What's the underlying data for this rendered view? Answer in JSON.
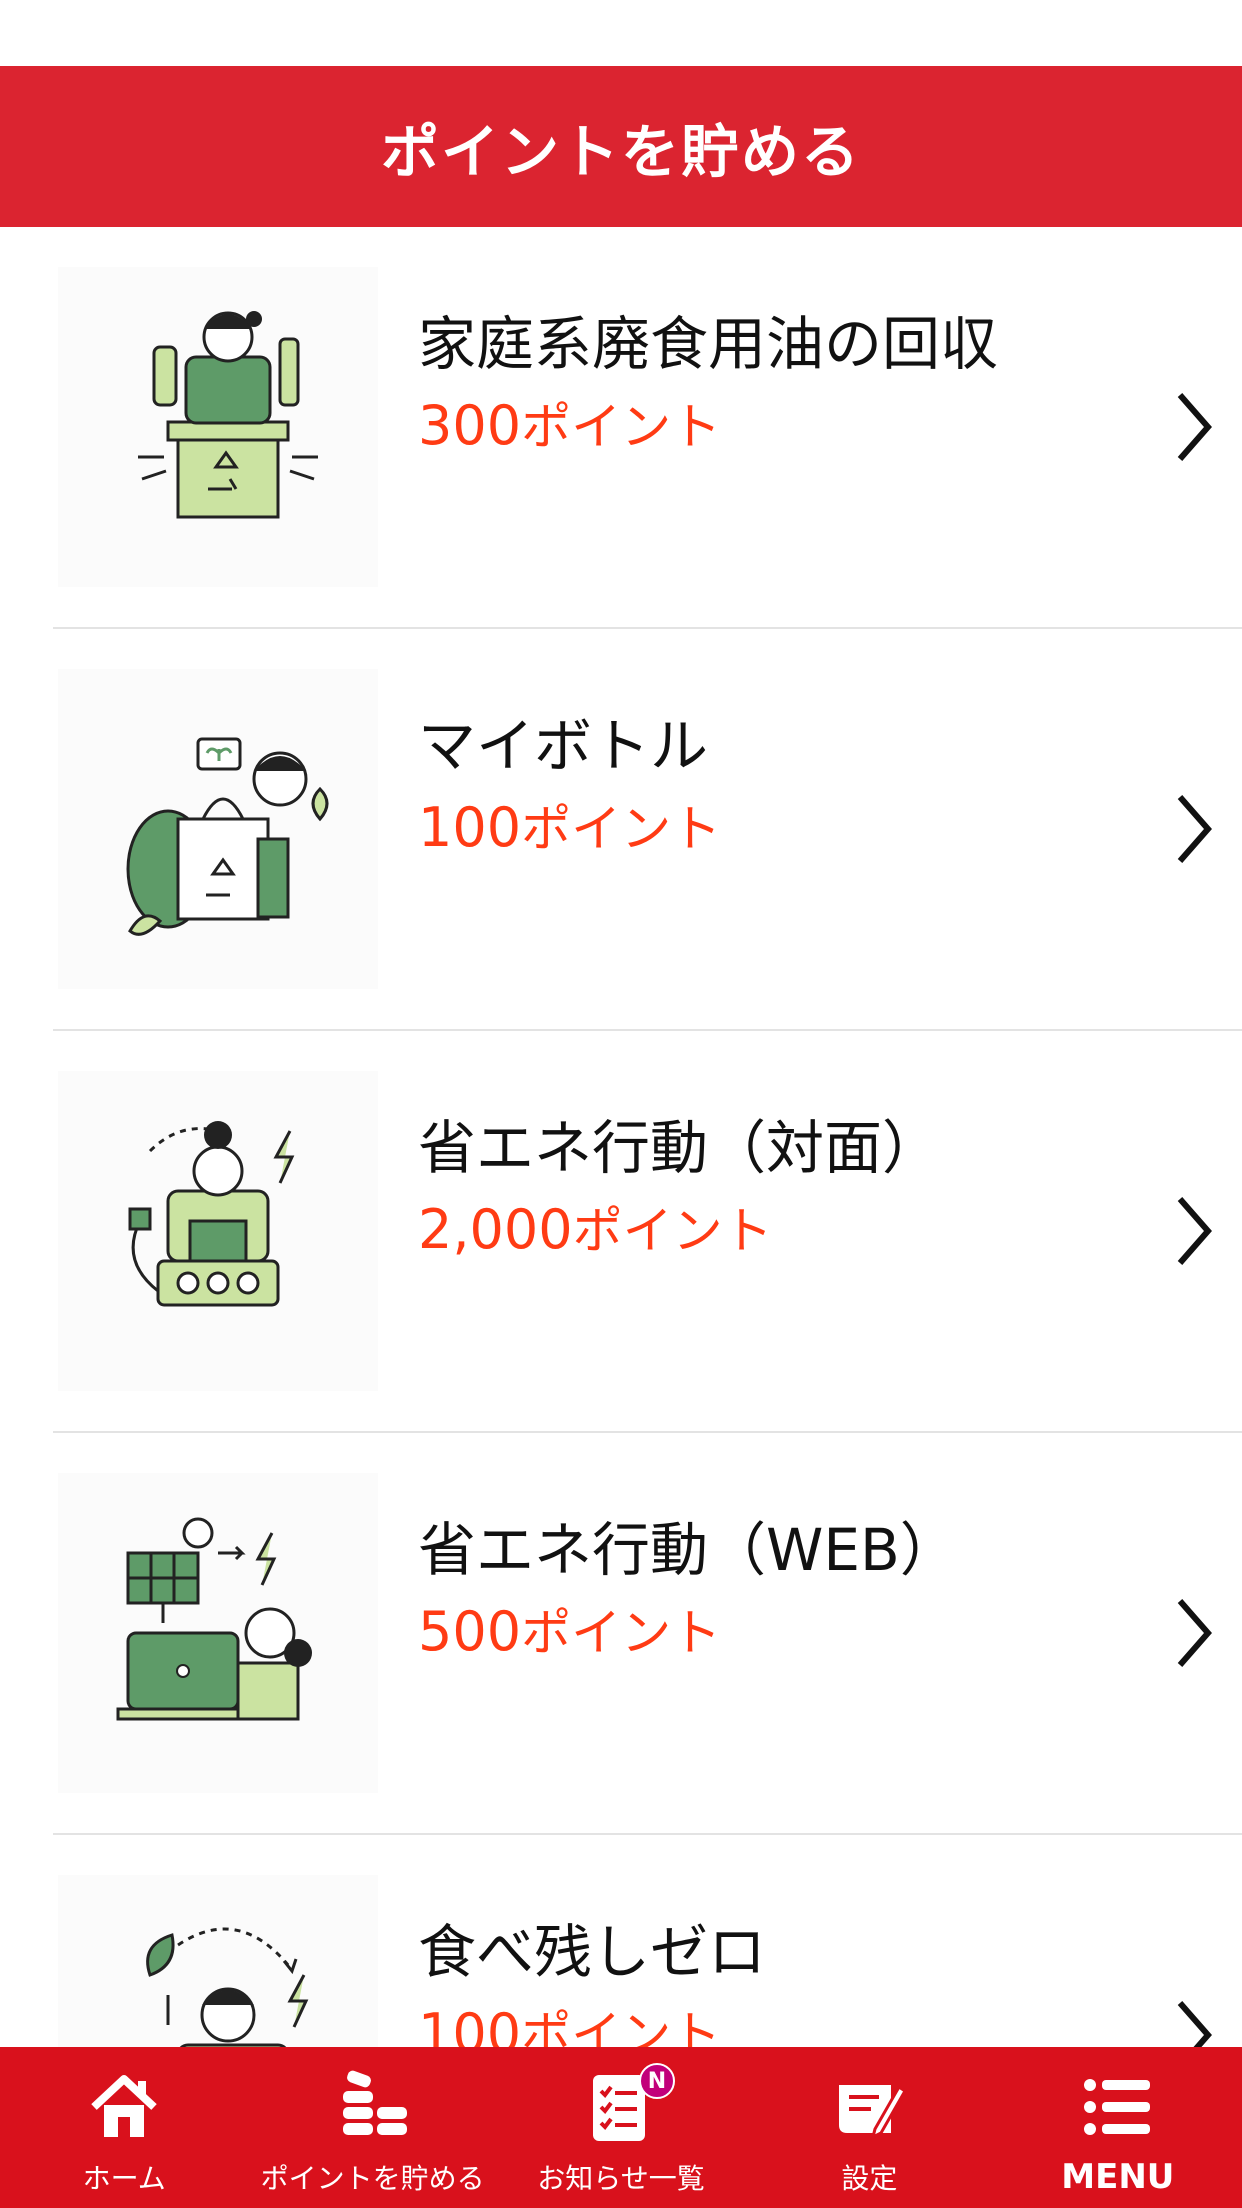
{
  "header": {
    "title": "ポイントを貯める"
  },
  "items": [
    {
      "name": "家庭系廃食用油の回収",
      "points_value": "300",
      "points_unit": "ポイント",
      "icon": "oil-recycling-illustration"
    },
    {
      "name": "マイボトル",
      "points_value": "100",
      "points_unit": "ポイント",
      "icon": "my-bottle-illustration"
    },
    {
      "name": "省エネ行動（対面）",
      "points_value": "2,000",
      "points_unit": "ポイント",
      "icon": "energy-saving-illustration"
    },
    {
      "name": "省エネ行動（WEB）",
      "points_value": "500",
      "points_unit": "ポイント",
      "icon": "web-energy-saving-illustration"
    },
    {
      "name": "食べ残しゼロ",
      "points_value": "100",
      "points_unit": "ポイント",
      "icon": "zero-food-waste-illustration"
    }
  ],
  "tabbar": {
    "tabs": [
      {
        "label": "ホーム",
        "icon": "home-icon"
      },
      {
        "label": "ポイントを貯める",
        "icon": "coins-icon"
      },
      {
        "label": "お知らせ一覧",
        "icon": "notice-icon",
        "badge": "N"
      },
      {
        "label": "設定",
        "icon": "settings-icon"
      },
      {
        "label": "MENU",
        "icon": "menu-icon"
      }
    ]
  },
  "colors": {
    "brand_red": "#db2430",
    "tabbar_red": "#d9111c",
    "points_orange": "#ff3b14",
    "illustration_green": "#5e9b68",
    "illustration_light": "#cbe3a1",
    "badge": "#c2007a"
  }
}
